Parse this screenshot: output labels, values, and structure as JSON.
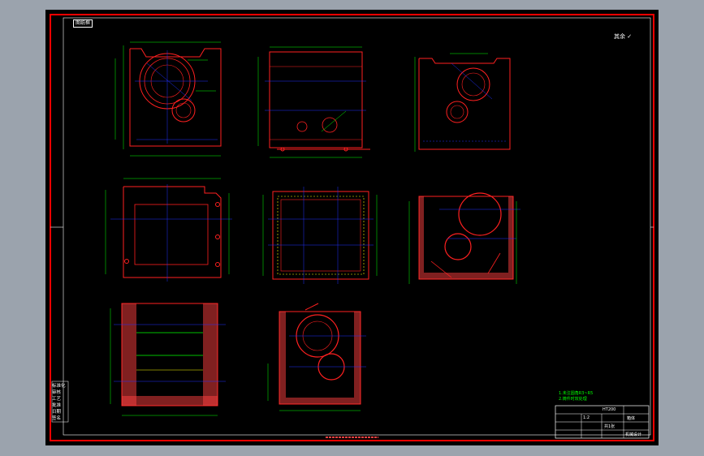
{
  "frame": {
    "tag": "图纸框",
    "corner_note": "其余 ✓"
  },
  "legend": {
    "items": [
      "标准化",
      "审核",
      "工艺",
      "批准",
      "日期",
      "签名"
    ]
  },
  "tech_requirements": {
    "lines": [
      "1.未注圆角R3~R5",
      "2.铸件时效处理"
    ]
  },
  "title_block": {
    "material": "HT200",
    "part_name": "箱体",
    "scale": "1:2",
    "sheet": "共1张",
    "school": "机械设计"
  },
  "colors": {
    "frame": "#ff0000",
    "outline": "#ff2020",
    "centerline": "#2030ff",
    "dimension": "#00ff00",
    "hatch": "#ff4040",
    "detail": "#ffffff",
    "accent": "#ffff00"
  }
}
